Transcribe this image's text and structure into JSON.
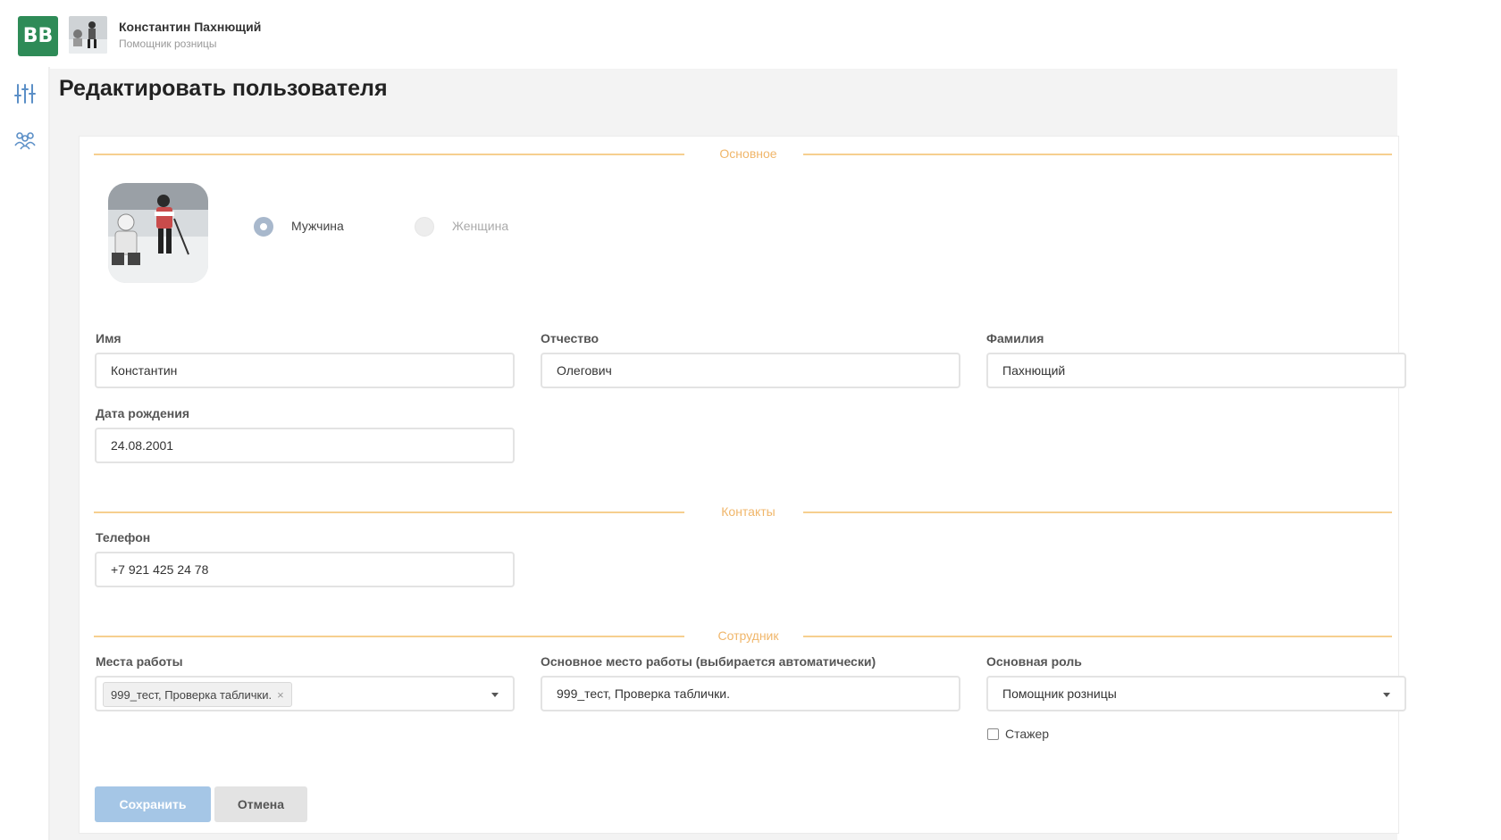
{
  "header": {
    "logo_text": "BB",
    "user_name": "Константин Пахнющий",
    "user_role": "Помощник розницы"
  },
  "sidebar": {
    "items": [
      {
        "icon": "sliders-icon"
      },
      {
        "icon": "users-icon"
      }
    ]
  },
  "page": {
    "title": "Редактировать пользователя"
  },
  "sections": {
    "main": "Основное",
    "contacts": "Контакты",
    "employee": "Сотрудник"
  },
  "gender": {
    "male": "Мужчина",
    "female": "Женщина",
    "selected": "male"
  },
  "fields": {
    "first_name": {
      "label": "Имя",
      "value": "Константин"
    },
    "patronymic": {
      "label": "Отчество",
      "value": "Олегович"
    },
    "last_name": {
      "label": "Фамилия",
      "value": "Пахнющий"
    },
    "birth_date": {
      "label": "Дата рождения",
      "value": "24.08.2001"
    },
    "phone": {
      "label": "Телефон",
      "value": "+7 921 425 24 78"
    },
    "workplaces": {
      "label": "Места работы",
      "tag": "999_тест, Проверка таблички.",
      "tag_remove": "×"
    },
    "main_workplace": {
      "label": "Основное место работы (выбирается автоматически)",
      "value": "999_тест, Проверка таблички."
    },
    "main_role": {
      "label": "Основная роль",
      "value": "Помощник розницы"
    },
    "intern": {
      "label": "Стажер",
      "checked": false
    }
  },
  "buttons": {
    "save": "Сохранить",
    "cancel": "Отмена"
  },
  "colors": {
    "brand": "#2e8b57",
    "section_accent": "#f0b66a",
    "save_button": "#a5c6e6",
    "icon_blue": "#5b8fc7"
  }
}
